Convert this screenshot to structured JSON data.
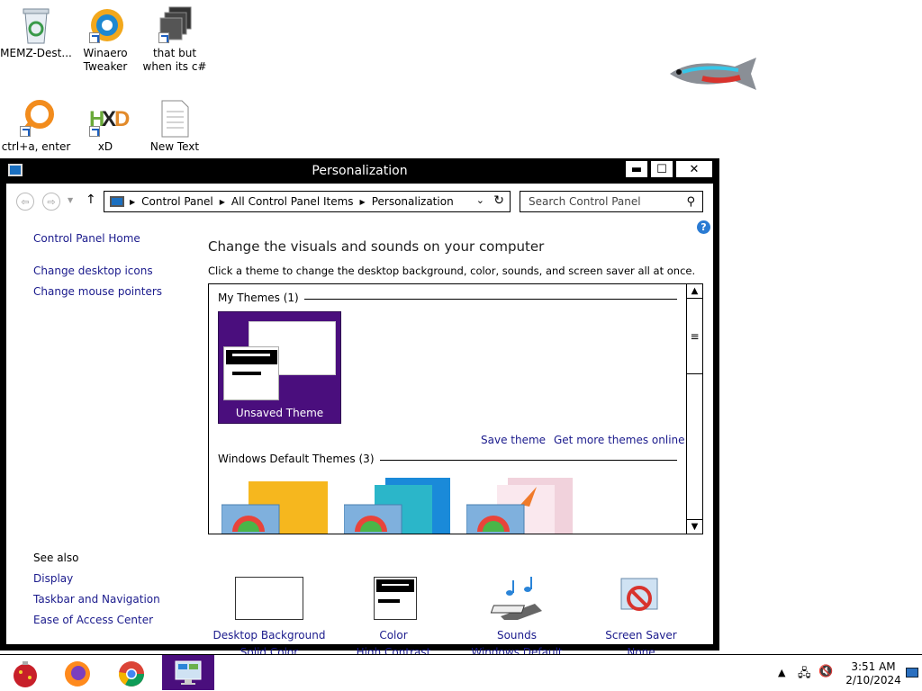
{
  "desktop": {
    "icons": [
      {
        "label": "MEMZ-Dest..."
      },
      {
        "label": "Winaero Tweaker"
      },
      {
        "label": "that but when its c#"
      },
      {
        "label": "ctrl+a, enter"
      },
      {
        "label": "xD"
      },
      {
        "label": "New Text"
      }
    ]
  },
  "window": {
    "title": "Personalization",
    "controls": {
      "minimize": "▬",
      "maximize": "☐",
      "close": "✕"
    },
    "breadcrumb": [
      "Control Panel",
      "All Control Panel Items",
      "Personalization"
    ],
    "search_placeholder": "Search Control Panel",
    "help": "?"
  },
  "sidebar": {
    "home": "Control Panel Home",
    "links": [
      "Change desktop icons",
      "Change mouse pointers"
    ],
    "see_also_label": "See also",
    "see_also": [
      "Display",
      "Taskbar and Navigation",
      "Ease of Access Center"
    ]
  },
  "main": {
    "heading": "Change the visuals and sounds on your computer",
    "subheading": "Click a theme to change the desktop background, color, sounds, and screen saver all at once.",
    "my_themes_label": "My Themes (1)",
    "unsaved_theme": "Unsaved Theme",
    "save_theme": "Save theme",
    "more_themes": "Get more themes online",
    "default_themes_label": "Windows Default Themes (3)"
  },
  "tiles": [
    {
      "name": "Desktop Background",
      "value": "Solid Color"
    },
    {
      "name": "Color",
      "value": "High Contrast"
    },
    {
      "name": "Sounds",
      "value": "Windows Default"
    },
    {
      "name": "Screen Saver",
      "value": "None"
    }
  ],
  "taskbar": {
    "time": "3:51 AM",
    "date": "2/10/2024"
  },
  "colors": {
    "link": "#1a1a8c",
    "theme_purple": "#4a0e7d",
    "taskbar_active": "#4a0e7d"
  }
}
